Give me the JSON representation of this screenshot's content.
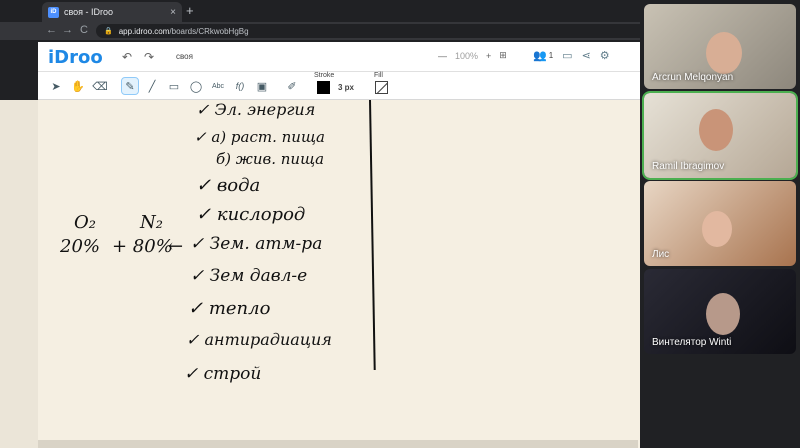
{
  "browser": {
    "tab_title": "своя - IDroo",
    "favicon": "iD",
    "tab_close": "×",
    "new_tab": "+",
    "back": "←",
    "forward": "→",
    "reload": "C",
    "url_host": "app.idroo.com",
    "url_path": "/boards/CRkwobHgBg"
  },
  "app": {
    "logo": "iDroo",
    "board_name": "своя",
    "zoom_minus": "—",
    "zoom_value": "100%",
    "zoom_plus": "+",
    "participants_count": "1",
    "stroke_label": "Stroke",
    "stroke_size": "3 px",
    "fill_label": "Fill",
    "stroke_color": "#000000",
    "accent": "#1e88e5"
  },
  "toolbar": {
    "tools": [
      "select-arrow",
      "hand",
      "eraser",
      "pen",
      "line",
      "rectangle",
      "ellipse",
      "text",
      "formula",
      "image",
      "color-picker"
    ],
    "text_tool_label": "Abc",
    "formula_tool_label": "f()"
  },
  "board": {
    "items": [
      "Эл. энергия",
      "а) раст. пища",
      "б) жив. пища",
      "вода",
      "кислород",
      "Зем. атм-ра",
      "Зем давл-е",
      "тепло",
      "антирадиация",
      "строй"
    ],
    "check_mark": "✓",
    "gas1": "O₂",
    "gas2": "N₂",
    "gas1_pct": "20%",
    "gas2_pct": "+ 80%",
    "arrow": "←"
  },
  "participants": [
    {
      "name": "Arcrun Melqonyan"
    },
    {
      "name": "Ramil Ibragimov"
    },
    {
      "name": "Лис"
    },
    {
      "name": "Винтелятор Winti"
    }
  ]
}
